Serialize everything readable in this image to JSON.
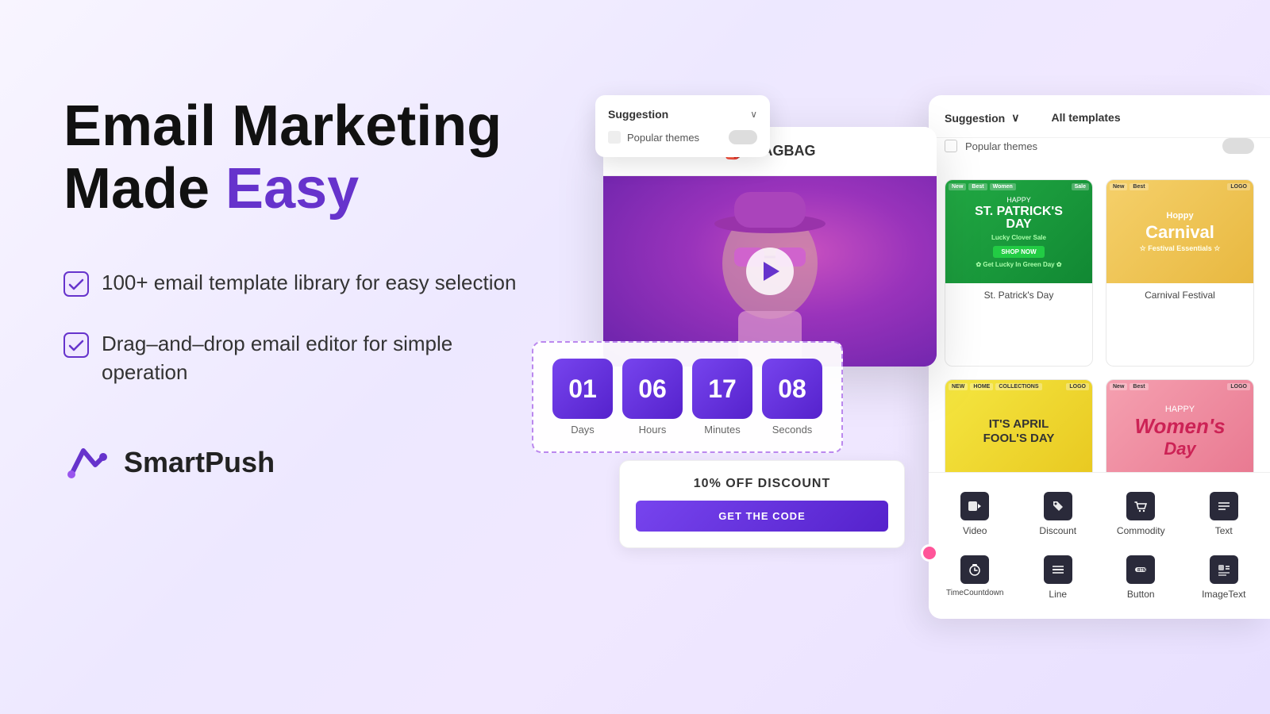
{
  "headline": {
    "line1": "Email Marketing",
    "line2_prefix": "Made ",
    "line2_highlight": "Easy"
  },
  "features": [
    {
      "id": "feature1",
      "text": "100+ email template library for easy selection"
    },
    {
      "id": "feature2",
      "text": "Drag–and–drop email editor for simple operation"
    }
  ],
  "logo": {
    "text": "SmartPush"
  },
  "email_preview": {
    "store_name": "BAGBAG"
  },
  "countdown": {
    "days": "01",
    "hours": "06",
    "minutes": "17",
    "seconds": "08",
    "days_label": "Days",
    "hours_label": "Hours",
    "minutes_label": "Minutes",
    "seconds_label": "Seconds"
  },
  "discount_card": {
    "title": "10% OFF DISCOUNT",
    "btn_label": "GET THE CODE"
  },
  "suggestion_panel": {
    "title": "Suggestion",
    "popular_themes_label": "Popular themes"
  },
  "all_templates_label": "All templates",
  "templates": [
    {
      "id": "st-patrick",
      "name": "St. Patrick's Day",
      "type": "st-patrick"
    },
    {
      "id": "carnival",
      "name": "Carnival Festival",
      "type": "carnival"
    },
    {
      "id": "april-fools",
      "name": "It's April Fool's Day",
      "type": "april-fools"
    },
    {
      "id": "womens-day",
      "name": "Happy Women's Day",
      "type": "womens-day"
    }
  ],
  "toolbar": {
    "items": [
      {
        "id": "video",
        "label": "Video",
        "icon": "▶"
      },
      {
        "id": "discount",
        "label": "Discount",
        "icon": "🏷"
      },
      {
        "id": "commodity",
        "label": "Commodity",
        "icon": "🛍"
      },
      {
        "id": "text",
        "label": "Text",
        "icon": "≡"
      },
      {
        "id": "timecountdown",
        "label": "TimeCountdown",
        "icon": "⏱"
      },
      {
        "id": "line",
        "label": "Line",
        "icon": "—"
      },
      {
        "id": "button",
        "label": "Button",
        "icon": "BTN"
      },
      {
        "id": "imagetext",
        "label": "ImageText",
        "icon": "🖼"
      }
    ]
  }
}
